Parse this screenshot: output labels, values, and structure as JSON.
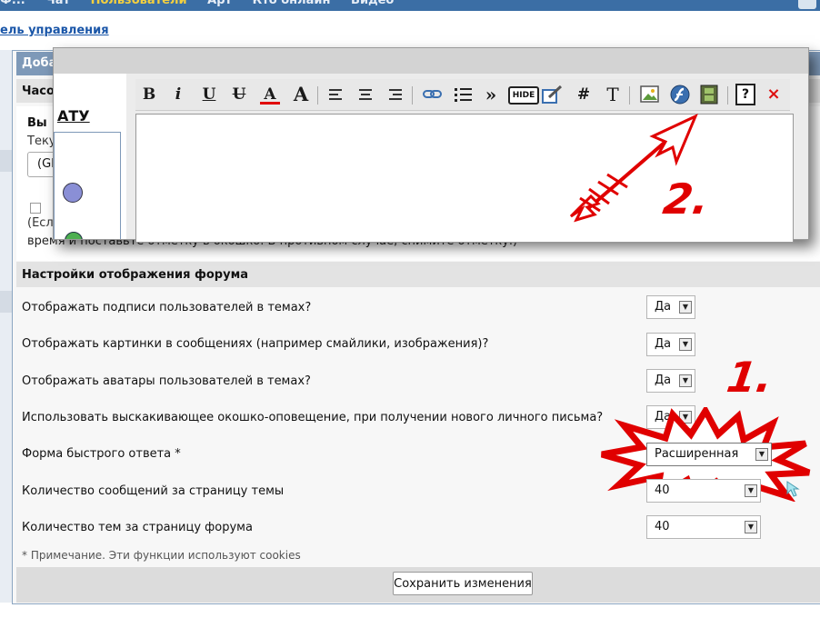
{
  "top_nav": [
    "Ф...",
    "Чат",
    "Пользователи",
    "Арт",
    "Кто онлайн",
    "Видео"
  ],
  "control_panel_link": "ель управления",
  "bg": {
    "blue_header": "Доба",
    "clock_header": "Часо",
    "vy": "Вы",
    "current": "Теку",
    "select_value": "(GM",
    "note_esl": "(Есл",
    "time_note": "время и поставьте отметку в окошко. В противном случае, снимите отметку.)"
  },
  "popup": {
    "tab_label": "Доба",
    "atu_label": "АТУ",
    "toolbar_glyphs": {
      "bold": "B",
      "italic": "i",
      "underline": "U",
      "strike": "U",
      "font_color": "A",
      "font_size": "A",
      "quote": "»",
      "hide": "HIDE",
      "hash": "#",
      "text": "T",
      "help": "?",
      "close": "×"
    }
  },
  "section_title": "Настройки отображения форума",
  "settings": [
    {
      "label": "Отображать подписи пользователей в темах?",
      "value": "Да"
    },
    {
      "label": "Отображать картинки в сообщениях (например смайлики, изображения)?",
      "value": "Да"
    },
    {
      "label": "Отображать аватары пользователей в темах?",
      "value": "Да"
    },
    {
      "label": "Использовать выскакивающее окошко-оповещение, при получении нового личного письма?",
      "value": "Да"
    },
    {
      "label": "Форма быстрого ответа *",
      "value": "Расширенная"
    },
    {
      "label": "Количество сообщений за страницу темы",
      "value": "40"
    },
    {
      "label": "Количество тем за страницу форума",
      "value": "40"
    }
  ],
  "footnote": "* Примечание. Эти функции используют cookies",
  "save_button": "Сохранить изменения",
  "annotations": {
    "one": "1.",
    "two": "2."
  },
  "colors": {
    "header_blue": "#7e99b8",
    "annotation_red": "#e00000",
    "link_blue": "#1a56a8"
  }
}
